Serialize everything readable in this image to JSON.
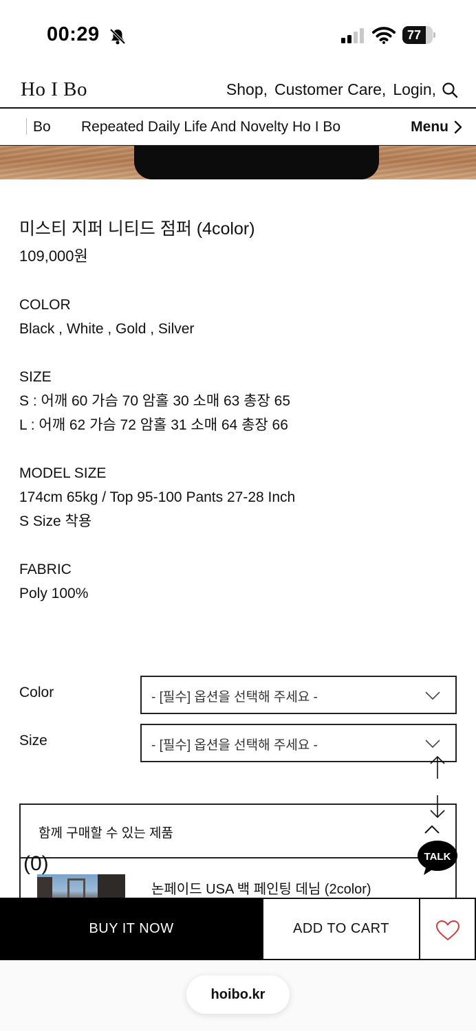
{
  "status_bar": {
    "time": "00:29",
    "battery_level": "77",
    "battery_fraction": 0.77
  },
  "header": {
    "logo": "Ho I Bo",
    "nav": [
      "Shop,",
      "Customer Care,",
      "Login,"
    ]
  },
  "marquee": {
    "text_a": "Bo",
    "text_b": "Repeated Daily Life And Novelty Ho I Bo",
    "menu_label": "Menu"
  },
  "product": {
    "name": "미스티 지퍼 니티드 점퍼 (4color)",
    "price": "109,000원",
    "color_heading": "COLOR",
    "colors": "Black , White , Gold , Silver",
    "size_heading": "SIZE",
    "size_s": "S : 어깨 60 가슴 70 암홀 30 소매 63 총장 65",
    "size_l": "L : 어깨 62 가슴 72 암홀 31 소매 64 총장 66",
    "model_heading": "MODEL SIZE",
    "model_body": "174cm 65kg / Top 95-100 Pants 27-28 Inch",
    "model_size": "S Size 착용",
    "fabric_heading": "FABRIC",
    "fabric": "Poly 100%"
  },
  "options": {
    "color_label": "Color",
    "color_value": "- [필수] 옵션을 선택해 주세요 -",
    "size_label": "Size",
    "size_value": "- [필수] 옵션을 선택해 주세요 -"
  },
  "related": {
    "title": "함께 구매할 수 있는 제품",
    "count": "(0)",
    "product_name": "논페이드 USA 백 페인팅 데님 (2color)"
  },
  "talk": {
    "label": "TALK"
  },
  "actions": {
    "buy_now": "BUY IT NOW",
    "add_to_cart": "ADD TO CART"
  },
  "browser": {
    "address": "hoibo.kr"
  },
  "colors": {
    "text": "#111111",
    "primary_button": "#000000",
    "heart": "#d23b3b",
    "background": "#ffffff"
  }
}
